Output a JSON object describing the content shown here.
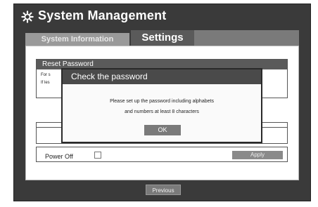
{
  "header": {
    "title": "System Management",
    "icon": "gear-icon"
  },
  "tabs": [
    {
      "label": "System Information",
      "active": false
    },
    {
      "label": "Settings",
      "active": true
    }
  ],
  "reset_password": {
    "header": "Reset Password",
    "line1": "For s",
    "line2": "If les"
  },
  "power_off": {
    "label": "Power Off",
    "apply_label": "Apply"
  },
  "dialog": {
    "title": "Check the password",
    "message_line1": "Please set up the password including alphabets",
    "message_line2": "and numbers at least 8 characters",
    "ok_label": "OK"
  },
  "footer": {
    "previous_label": "Previous"
  },
  "colors": {
    "frame": "#3a3a3a",
    "tab_active": "#5a5a5a",
    "button": "#7a7a7a"
  }
}
